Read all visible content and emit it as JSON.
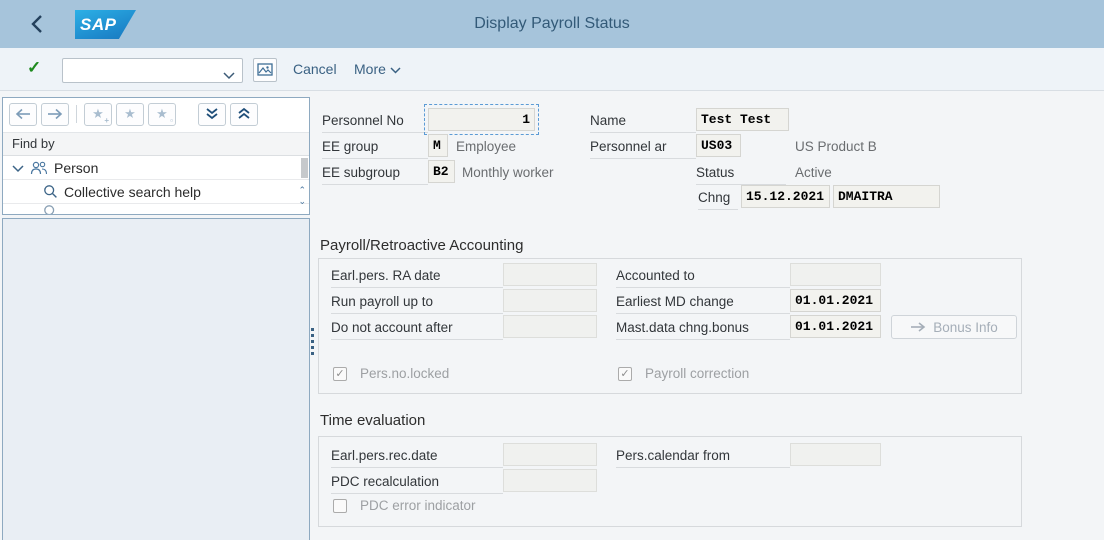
{
  "colors": {
    "titlebar_bg": "#a6c4db",
    "title_text": "#335a78",
    "toolbar_bg": "#eef3f8",
    "logo_blue": "#1d87cb",
    "check_green": "#1e8a1e",
    "link_blue": "#3a6183",
    "panel_border": "#8ea9c0",
    "field_bg": "#f2f2ee",
    "disabled_text": "#9da0a3"
  },
  "header": {
    "logo_text": "SAP",
    "title": "Display Payroll Status"
  },
  "toolbar": {
    "cancel_label": "Cancel",
    "more_label": "More",
    "command_value": ""
  },
  "sidebar": {
    "find_by_label": "Find by",
    "tree": [
      {
        "label": "Person"
      },
      {
        "label": "Collective search help"
      }
    ]
  },
  "form": {
    "personnel_no": {
      "label": "Personnel No",
      "value": "1"
    },
    "name": {
      "label": "Name",
      "value": "Test Test"
    },
    "ee_group": {
      "label": "EE group",
      "value": "M",
      "desc": "Employee"
    },
    "personnel_area": {
      "label": "Personnel ar",
      "value": "US03",
      "desc": "US Product B"
    },
    "ee_subgroup": {
      "label": "EE subgroup",
      "value": "B2",
      "desc": "Monthly worker"
    },
    "status": {
      "label": "Status",
      "value": "Active"
    },
    "chng": {
      "label": "Chng",
      "date": "15.12.2021",
      "user": "DMAITRA"
    }
  },
  "payroll_section": {
    "title": "Payroll/Retroactive Accounting",
    "earl_pers_ra_date": {
      "label": "Earl.pers. RA date",
      "value": ""
    },
    "run_payroll_up_to": {
      "label": "Run payroll up to",
      "value": ""
    },
    "do_not_account_after": {
      "label": "Do not account after",
      "value": ""
    },
    "accounted_to": {
      "label": "Accounted to",
      "value": ""
    },
    "earliest_md_change": {
      "label": "Earliest MD change",
      "value": "01.01.2021"
    },
    "mast_data_chng_bonus": {
      "label": "Mast.data chng.bonus",
      "value": "01.01.2021"
    },
    "bonus_button_label": "Bonus Info",
    "pers_no_locked": {
      "label": "Pers.no.locked",
      "checked": "✓"
    },
    "payroll_correction": {
      "label": "Payroll correction",
      "checked": "✓"
    }
  },
  "time_section": {
    "title": "Time evaluation",
    "earl_pers_rec_date": {
      "label": "Earl.pers.rec.date",
      "value": ""
    },
    "pdc_recalculation": {
      "label": "PDC recalculation",
      "value": ""
    },
    "pers_calendar_from": {
      "label": "Pers.calendar from",
      "value": ""
    },
    "pdc_error_indicator": {
      "label": "PDC error indicator",
      "checked": ""
    }
  }
}
